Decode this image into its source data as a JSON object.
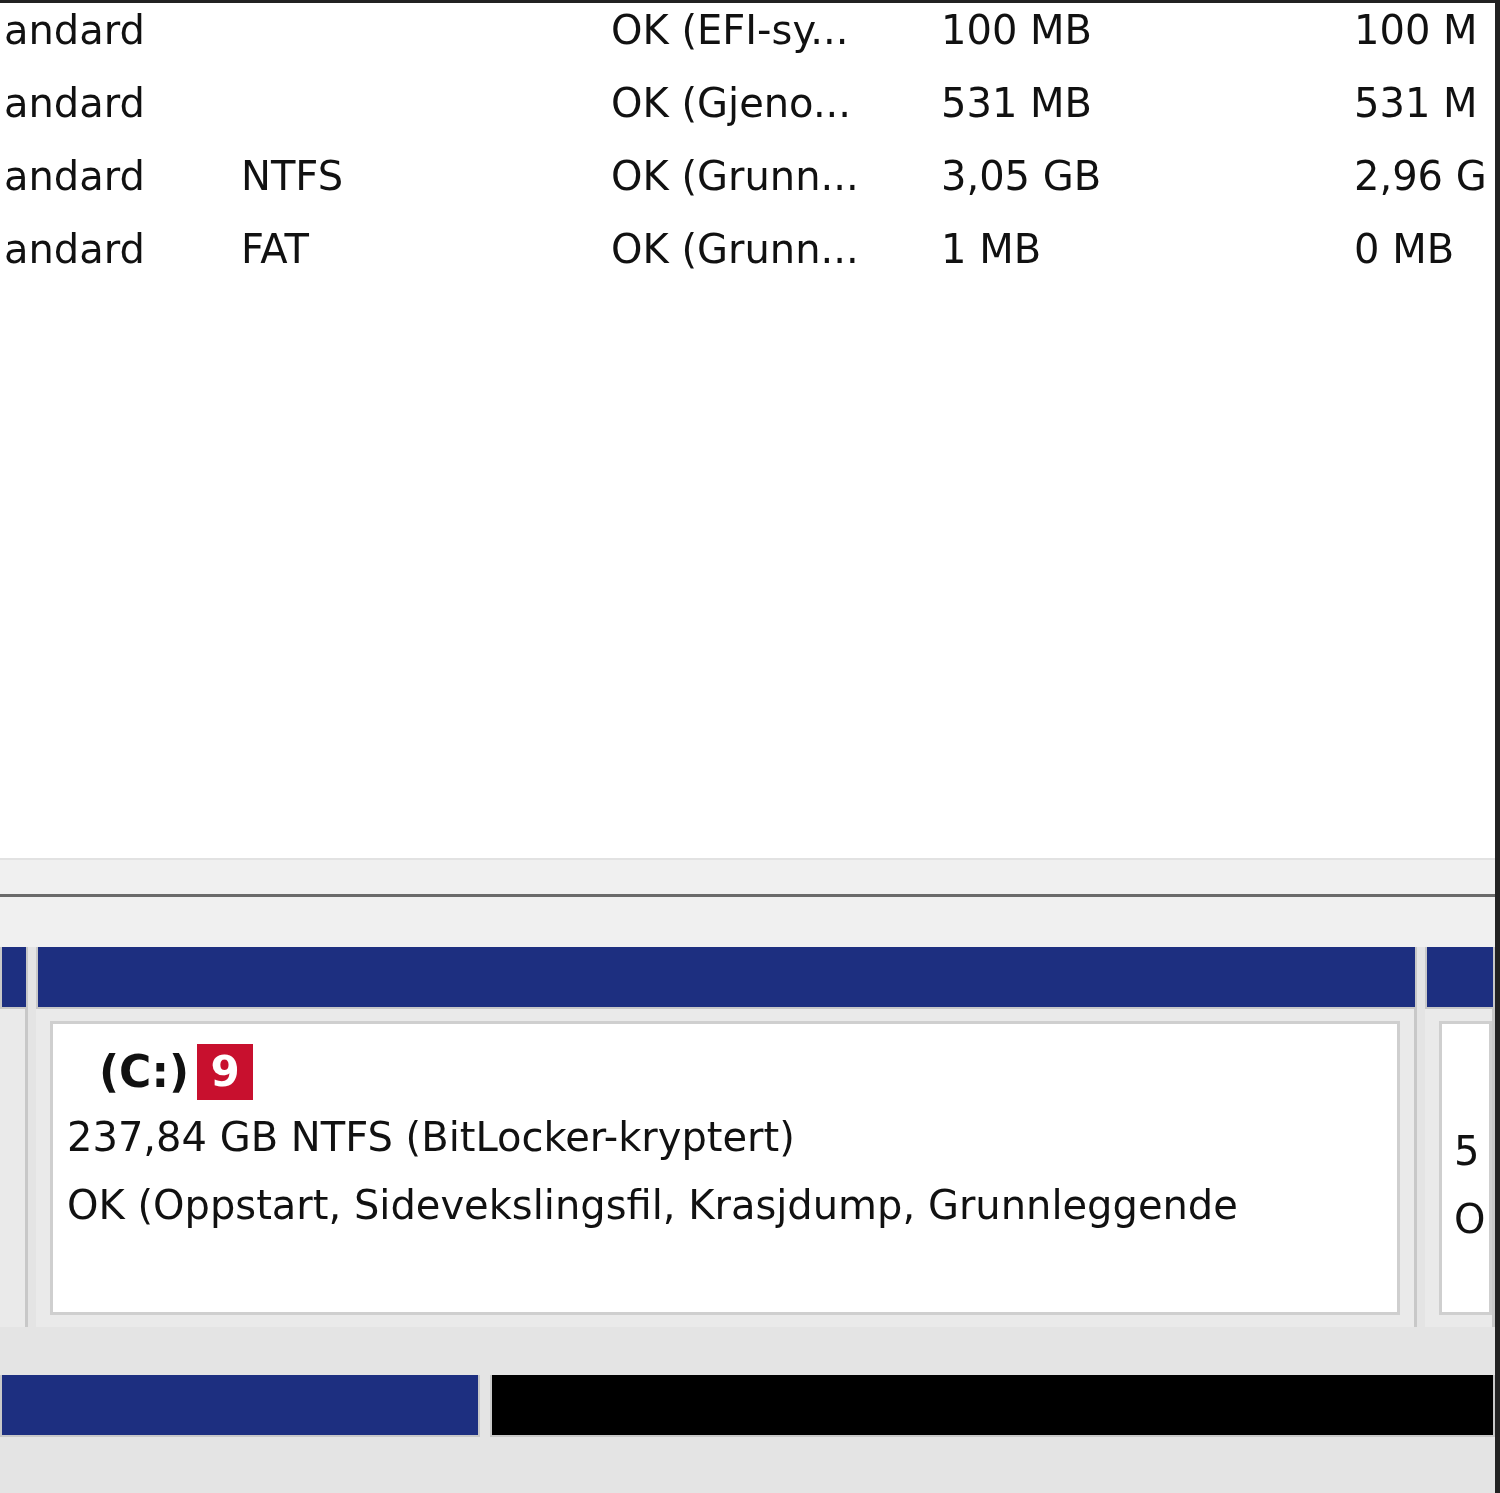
{
  "volume_table": {
    "rows": [
      {
        "column_1": "andard",
        "column_3": "OK (EFI-sy...",
        "column_4": "100 MB",
        "column_5": "100 M"
      },
      {
        "column_1": "andard",
        "column_3": "OK (Gjeno...",
        "column_4": "531 MB",
        "column_5": "531 M"
      },
      {
        "column_1": "andard",
        "column_2": "NTFS",
        "column_3": "OK (Grunn...",
        "column_4": "3,05 GB",
        "column_5": "2,96 G"
      },
      {
        "column_1": "andard",
        "column_2": "FAT",
        "column_3": "OK (Grunn...",
        "column_4": "1 MB",
        "column_5": "0 MB"
      }
    ]
  },
  "disk_map": [
    {
      "partitions": [
        {
          "kind": "sliver",
          "color": "#1d2f80"
        },
        {
          "kind": "volume",
          "color": "#1d2f80",
          "name": "(C:)",
          "badge": "9",
          "size": "237,84 GB NTFS (BitLocker-kryptert)",
          "status": "OK (Oppstart, Sidevekslingsfil, Krasjdump, Grunnleggende"
        },
        {
          "kind": "edge",
          "color": "#1d2f80",
          "lines": [
            "5",
            "O"
          ]
        }
      ]
    },
    {
      "partitions": [
        {
          "kind": "sliver",
          "color": "#1d2f80"
        },
        {
          "kind": "sliver",
          "color": "#000000"
        }
      ]
    }
  ]
}
